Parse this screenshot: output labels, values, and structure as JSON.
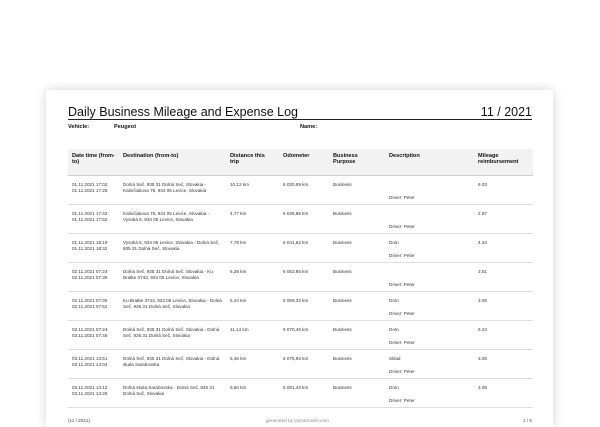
{
  "document": {
    "title": "Daily Business Mileage and Expense Log",
    "period": "11 / 2021",
    "vehicle_label": "Vehicle:",
    "vehicle_value": "Peugeot",
    "name_label": "Name:",
    "name_value": ""
  },
  "table": {
    "headers": {
      "datetime": "Date time (from-to)",
      "destination": "Destination (from-to)",
      "distance": "Distance this trip",
      "odometer": "Odometer",
      "purpose": "Business Purpose",
      "description": "Description",
      "reimbursement": "Mileage reimbursement"
    },
    "rows": [
      {
        "datetime": "01.11.2021 17:02\n01.11.2021 17:25",
        "destination": "Dolná Seč, 935 31 Dolná Seč, Slovakia - Kalinčiakova 76, 934 05 Levice, Slovakia",
        "distance": "10,12 km",
        "odometer": "6 030,59 km",
        "purpose": "Business",
        "desc_top": "",
        "desc_bottom": "Driver: Peter",
        "reimbursement": "6.03"
      },
      {
        "datetime": "01.11.2021 17:42\n01.11.2021 17:52",
        "destination": "Kalinčiakova 76, 934 05 Levice, Slovakia - Vysoká 5, 934 05 Levice, Slovakia",
        "distance": "4,77 km",
        "odometer": "6 035,85 km",
        "purpose": "Business",
        "desc_top": "",
        "desc_bottom": "Driver: Peter",
        "reimbursement": "2.87"
      },
      {
        "datetime": "01.11.2021 18:19\n01.11.2021 18:32",
        "destination": "Vysoká 5, 934 05 Levice, Slovakia - Dolná Seč, 935 31 Dolná Seč, Slovakia",
        "distance": "7,79 km",
        "odometer": "6 041,62 km",
        "purpose": "Business",
        "desc_top": "Dom",
        "desc_bottom": "Driver: Peter",
        "reimbursement": "4.34"
      },
      {
        "datetime": "02.11.2021 07:24\n02.11.2021 07:39",
        "destination": "Dolná Seč, 935 31 Dolná Seč, Slovakia - Ku Bratke 3743, 934 05 Levice, Slovakia",
        "distance": "6,28 km",
        "odometer": "6 053,85 km",
        "purpose": "Business",
        "desc_top": "",
        "desc_bottom": "Driver: Peter",
        "reimbursement": "3.51"
      },
      {
        "datetime": "02.11.2021 07:39\n02.11.2021 07:52",
        "destination": "Ku Bratke 3743, 934 05 Levice, Slovakia - Dolná Seč, 935 31 Dolná Seč, Slovakia",
        "distance": "5,44 km",
        "odometer": "6 059,32 km",
        "purpose": "Business",
        "desc_top": "Dom",
        "desc_bottom": "Driver: Peter",
        "reimbursement": "3.05"
      },
      {
        "datetime": "03.11.2021 07:24\n03.11.2021 07:45",
        "destination": "Dolná Seč, 935 31 Dolná Seč, Slovakia - Dolná Seč, 935 31 Dolná Seč, Slovakia",
        "distance": "11,14 km",
        "odometer": "6 070,46 km",
        "purpose": "Business",
        "desc_top": "Dom",
        "desc_bottom": "Driver: Peter",
        "reimbursement": "6.24"
      },
      {
        "datetime": "03.11.2021 13:51\n03.11.2021 14:04",
        "destination": "Dolná Seč, 935 31 Dolná Seč, Slovakia - Dolná skala Sarabovska",
        "distance": "5,46 km",
        "odometer": "6 075,93 km",
        "purpose": "Business",
        "desc_top": "Sklad",
        "desc_bottom": "Driver: Peter",
        "reimbursement": "3.06"
      },
      {
        "datetime": "03.11.2021 14:12\n03.11.2021 14:26",
        "destination": "Dolná skala Sarabovska - Dolná Seč, 935 31 Dolná Seč, Slovakia",
        "distance": "5,50 km",
        "odometer": "6 081,43 km",
        "purpose": "Business",
        "desc_top": "Dom",
        "desc_bottom": "Driver: Peter",
        "reimbursement": "3.08"
      }
    ]
  },
  "footer": {
    "left": "(11 / 2021)",
    "center": "generated by mycartracks.com",
    "right": "1 / 5"
  }
}
